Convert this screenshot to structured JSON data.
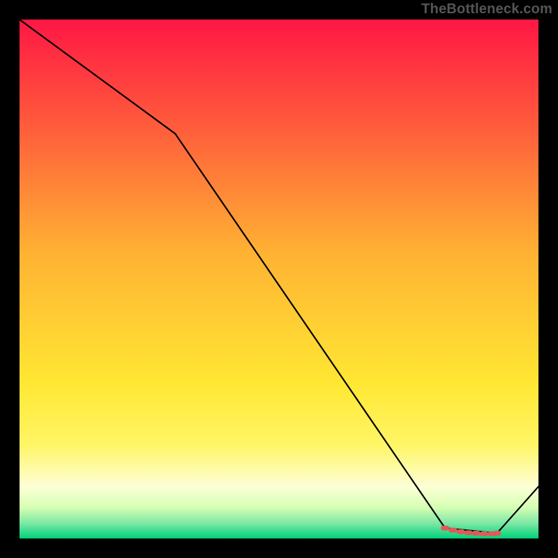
{
  "attribution": "TheBottleneck.com",
  "chart_data": {
    "type": "line",
    "title": "",
    "xlabel": "",
    "ylabel": "",
    "xlim": [
      0,
      100
    ],
    "ylim": [
      0,
      100
    ],
    "x": [
      0,
      30,
      82,
      92,
      100
    ],
    "values": [
      100,
      78,
      2,
      1,
      10
    ],
    "markers": {
      "x": [
        82,
        83.5,
        85,
        86.5,
        88,
        89.5,
        91,
        92
      ],
      "values": [
        2,
        1.6,
        1.3,
        1.1,
        1.0,
        0.9,
        0.9,
        1.0
      ],
      "color": "#e05a5a"
    },
    "background_gradient": {
      "stops": [
        {
          "offset": 0,
          "color": "#ff1744"
        },
        {
          "offset": 0.2,
          "color": "#ff5a3c"
        },
        {
          "offset": 0.45,
          "color": "#ffb233"
        },
        {
          "offset": 0.7,
          "color": "#ffe733"
        },
        {
          "offset": 0.82,
          "color": "#fff566"
        },
        {
          "offset": 0.9,
          "color": "#fdffd6"
        },
        {
          "offset": 0.94,
          "color": "#d6ffb3"
        },
        {
          "offset": 0.97,
          "color": "#7fe8a6"
        },
        {
          "offset": 1.0,
          "color": "#00d27a"
        }
      ]
    }
  }
}
